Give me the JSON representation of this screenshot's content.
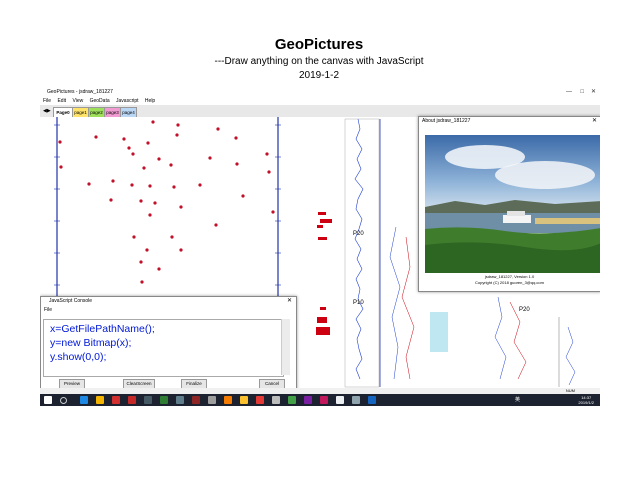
{
  "slide": {
    "title": "GeoPictures",
    "subtitle": "---Draw anything on the canvas with JavaScript",
    "date": "2019-1-2"
  },
  "app": {
    "window_title": "GeoPictures - jsdraw_181227",
    "menu": [
      "File",
      "Edit",
      "View",
      "GeoData",
      "Javascript",
      "Help"
    ],
    "tabs": [
      {
        "label": "Page0",
        "color": "#ffffff"
      },
      {
        "label": "page1",
        "color": "#ffe36b"
      },
      {
        "label": "page2",
        "color": "#9ee05b"
      },
      {
        "label": "page3",
        "color": "#f29bd3"
      },
      {
        "label": "page4",
        "color": "#b9d6f5"
      }
    ],
    "status": "NUM"
  },
  "well_labels": [
    "P20",
    "P10",
    "P20"
  ],
  "console": {
    "title": "JavaScript Console",
    "menu": "File",
    "code": [
      "x=GetFilePathName();",
      "y=new Bitmap(x);",
      "y.show(0,0);"
    ],
    "buttons": [
      "Preview",
      "ClearScreen",
      "Finalize",
      "Cancel"
    ]
  },
  "about": {
    "title": "About jsdraw_181227",
    "version": "jsdraw_181227, Version 1.0",
    "copyright": "Copyright (C) 2018 guoren_3@qq.com"
  },
  "taskbar": {
    "time": "14:37",
    "date": "2019/1/2",
    "lang": "英"
  }
}
